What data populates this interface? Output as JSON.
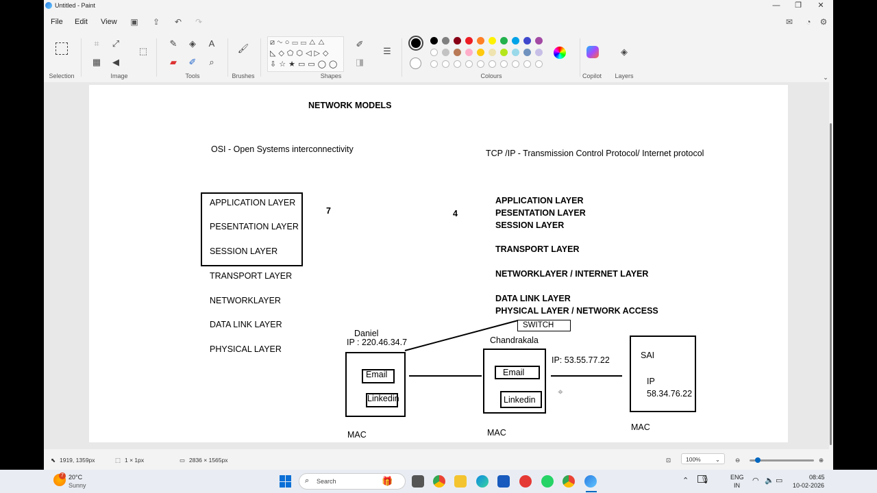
{
  "window": {
    "title": "Untitled - Paint",
    "controls": {
      "minimize": "—",
      "maximize": "❐",
      "close": "✕"
    }
  },
  "menu": {
    "file": "File",
    "edit": "Edit",
    "view": "View"
  },
  "ribbon": {
    "groups": {
      "selection": "Selection",
      "image": "Image",
      "tools": "Tools",
      "brushes": "Brushes",
      "shapes": "Shapes",
      "colours": "Colours",
      "copilot": "Copilot",
      "layers": "Layers"
    },
    "palette_row1": [
      "#000000",
      "#7f7f7f",
      "#880015",
      "#ed1c24",
      "#ff7f27",
      "#fff200",
      "#22b14c",
      "#00a2e8",
      "#3f48cc",
      "#a349a4"
    ],
    "palette_row2": [
      "#ffffff",
      "#c3c3c3",
      "#b97a57",
      "#ffaec9",
      "#ffc90e",
      "#efe4b0",
      "#b5e61d",
      "#99d9ea",
      "#7092be",
      "#c8bfe7"
    ],
    "primary_color": "#000000"
  },
  "canvas": {
    "heading": "NETWORK MODELS",
    "osi_title": "OSI - Open Systems interconnectivity",
    "tcp_title": "TCP /IP - Transmission Control Protocol/ Internet protocol",
    "osi_count": "7",
    "tcp_count": "4",
    "osi_layers": [
      "APPLICATION LAYER",
      "PESENTATION LAYER",
      "SESSION LAYER",
      "TRANSPORT LAYER",
      "NETWORKLAYER",
      "DATA LINK LAYER",
      "PHYSICAL LAYER"
    ],
    "tcp_layers": [
      "APPLICATION LAYER",
      "PESENTATION LAYER",
      "SESSION LAYER",
      "TRANSPORT LAYER",
      "NETWORKLAYER / INTERNET LAYER",
      "DATA LINK LAYER",
      "PHYSICAL LAYER / NETWORK ACCESS"
    ],
    "switch_label": "SWITCH",
    "hosts": {
      "daniel": {
        "name": "Daniel",
        "ip": "IP : 220.46.34.7",
        "app1": "Email",
        "app2": "Linkedin",
        "mac": "MAC"
      },
      "chandrakala": {
        "name": "Chandrakala",
        "ip": "IP: 53.55.77.22",
        "app1": "Email",
        "app2": "Linkedin",
        "mac": "MAC"
      },
      "sai": {
        "name": "SAI",
        "ip_label": "IP",
        "ip": "58.34.76.22",
        "mac": "MAC"
      }
    }
  },
  "status": {
    "cursor_pos": "1919, 1359px",
    "selection_size": "1 × 1px",
    "canvas_size": "2836 × 1565px",
    "zoom": "100%"
  },
  "taskbar": {
    "weather_temp": "20°C",
    "weather_desc": "Sunny",
    "weather_badge": "7",
    "search_placeholder": "Search",
    "lang1": "ENG",
    "lang2": "IN",
    "time": "08:45",
    "date": "10-02-2026"
  }
}
